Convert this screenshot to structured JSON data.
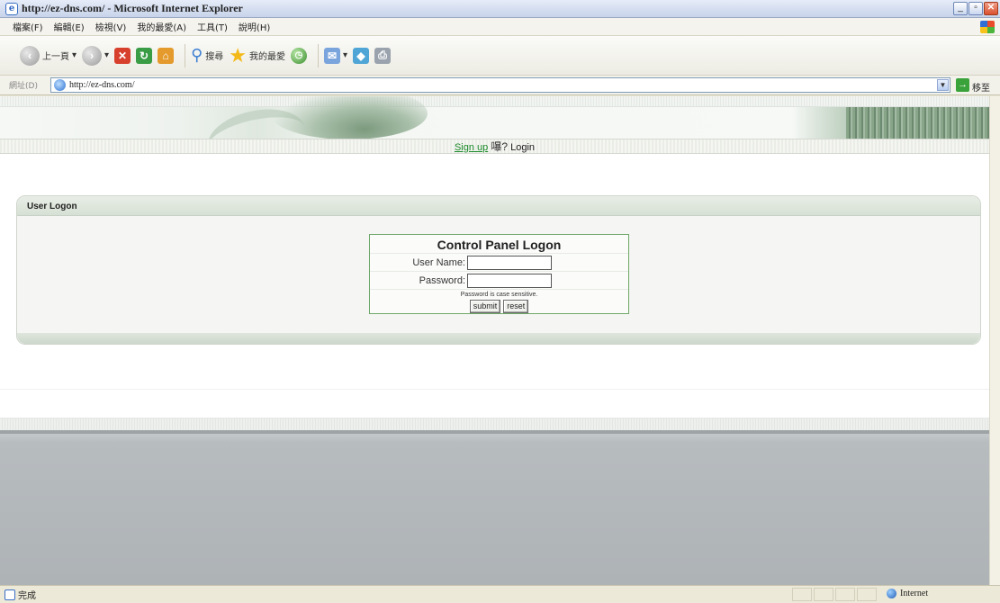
{
  "window": {
    "title": "http://ez-dns.com/ - Microsoft Internet Explorer"
  },
  "menu": {
    "items": [
      "檔案(F)",
      "編輯(E)",
      "檢視(V)",
      "我的最愛(A)",
      "工具(T)",
      "說明(H)"
    ]
  },
  "toolbar": {
    "back_label": "上一頁",
    "search_label": "搜尋",
    "favorites_label": "我的最愛"
  },
  "address": {
    "label": "網址(D)",
    "url": "http://ez-dns.com/",
    "go_label": "移至"
  },
  "nav": {
    "signup": "Sign up",
    "separator": "嚗?",
    "login": "Login"
  },
  "panel": {
    "title": "User Logon",
    "form_title": "Control Panel Logon",
    "username_label": "User Name:",
    "username_value": "",
    "password_label": "Password:",
    "password_value": "",
    "note": "Password is case sensitive.",
    "submit_label": "submit",
    "reset_label": "reset"
  },
  "status": {
    "text": "完成",
    "zone": "Internet"
  }
}
